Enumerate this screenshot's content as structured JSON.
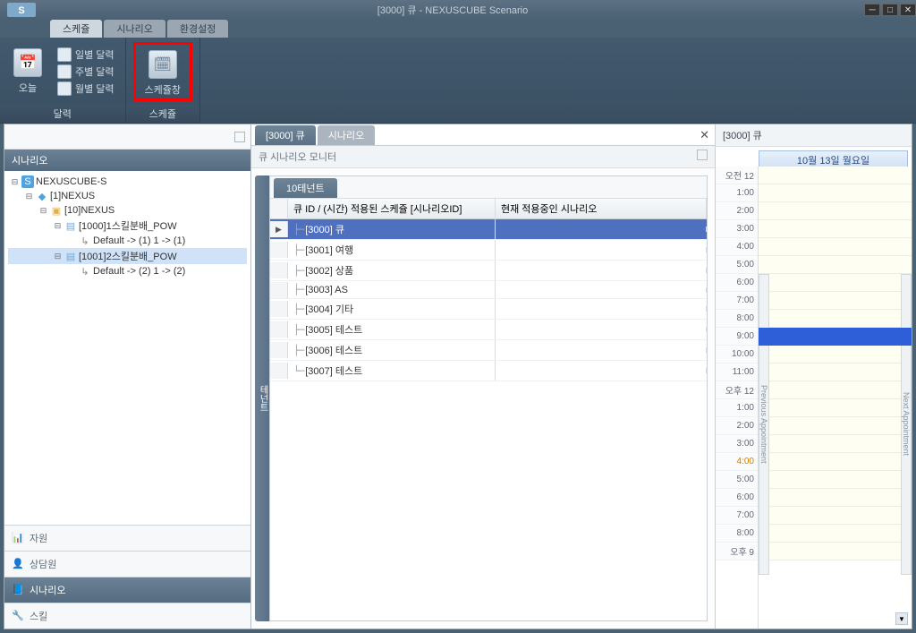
{
  "window": {
    "title": "[3000] 큐 - NEXUSCUBE Scenario"
  },
  "topTabs": [
    "스케쥴",
    "시나리오",
    "환경설정"
  ],
  "ribbon": {
    "g1": {
      "today": "오늘",
      "label": "달력",
      "items": [
        "일별 달력",
        "주별 달력",
        "월별 달력"
      ]
    },
    "g2": {
      "btn": "스케쥴창",
      "label": "스케쥴"
    }
  },
  "left": {
    "header": "시나리오",
    "tree": [
      {
        "d": 0,
        "exp": "⊟",
        "icon": "app",
        "t": "NEXUSCUBE-S"
      },
      {
        "d": 1,
        "exp": "⊟",
        "icon": "cube",
        "t": "[1]NEXUS"
      },
      {
        "d": 2,
        "exp": "⊟",
        "icon": "fold",
        "t": "[10]NEXUS"
      },
      {
        "d": 3,
        "exp": "⊟",
        "icon": "page",
        "t": "[1000]1스킬분배_POW"
      },
      {
        "d": 4,
        "exp": "",
        "icon": "route",
        "t": "Default -> (1)  1 -> (1)"
      },
      {
        "d": 3,
        "exp": "⊟",
        "icon": "page",
        "t": "[1001]2스킬분배_POW",
        "sel": true
      },
      {
        "d": 4,
        "exp": "",
        "icon": "route",
        "t": "Default -> (2)  1 -> (2)"
      }
    ],
    "nav": [
      {
        "t": "자원",
        "icon": "📊"
      },
      {
        "t": "상담원",
        "icon": "👤"
      },
      {
        "t": "시나리오",
        "icon": "📘",
        "active": true
      },
      {
        "t": "스킬",
        "icon": "🔧"
      }
    ]
  },
  "center": {
    "tabs": [
      "[3000] 큐",
      "시나리오"
    ],
    "subheader": "큐 시나리오 모니터",
    "tenant_tab": "10테넌트",
    "vtab": "테넌트",
    "columns": [
      "큐 ID / (시간) 적용된 스케쥴 [시나리오ID]",
      "현재 적용중인 시나리오"
    ],
    "rows": [
      {
        "t": "[3000] 큐",
        "sel": true
      },
      {
        "t": "[3001] 여행"
      },
      {
        "t": "[3002] 상품"
      },
      {
        "t": "[3003] AS"
      },
      {
        "t": "[3004] 기타"
      },
      {
        "t": "[3005] 테스트"
      },
      {
        "t": "[3006] 테스트"
      },
      {
        "t": "[3007] 테스트"
      }
    ]
  },
  "right": {
    "header": "[3000] 큐",
    "date": "10월 13일 월요일",
    "prev": "Previous Appointment",
    "next": "Next Appointment",
    "times": [
      {
        "t": "오전 12"
      },
      {
        "t": "1:00"
      },
      {
        "t": "2:00"
      },
      {
        "t": "3:00"
      },
      {
        "t": "4:00"
      },
      {
        "t": "5:00"
      },
      {
        "t": "6:00"
      },
      {
        "t": "7:00"
      },
      {
        "t": "8:00"
      },
      {
        "t": "9:00"
      },
      {
        "t": "10:00"
      },
      {
        "t": "11:00"
      },
      {
        "t": "오후 12"
      },
      {
        "t": "1:00"
      },
      {
        "t": "2:00"
      },
      {
        "t": "3:00"
      },
      {
        "t": "4:00",
        "sp": true
      },
      {
        "t": "5:00"
      },
      {
        "t": "6:00"
      },
      {
        "t": "7:00"
      },
      {
        "t": "8:00"
      },
      {
        "t": "오후 9"
      }
    ]
  }
}
